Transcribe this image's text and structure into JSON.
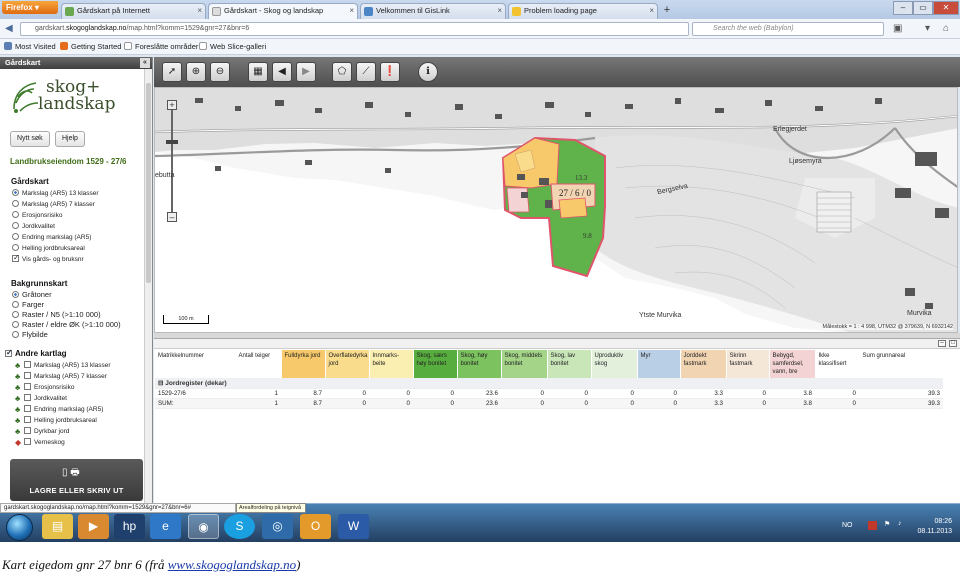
{
  "browser": {
    "menu_label": "Firefox",
    "tabs": [
      {
        "label": "Gårdskart på Internett",
        "favicon": "green-leaf-icon"
      },
      {
        "label": "Gårdskart - Skog og landskap",
        "favicon": "page-icon"
      },
      {
        "label": "Velkommen til GisLink",
        "favicon": "gislink-icon"
      },
      {
        "label": "Problem loading page",
        "favicon": "warning-icon"
      }
    ],
    "new_tab_label": "+",
    "url_prefix": "gardskart.",
    "url_domain": "skogoglandskap.no",
    "url_suffix": "/map.html?komm=1529&gnr=27&bnr=6",
    "search_placeholder": "Search the web (Babylon)",
    "bookmarks": [
      "Most Visited",
      "Getting Started",
      "Foreslåtte områder",
      "Web Slice-galleri"
    ]
  },
  "left_panel": {
    "header": "Gårdskart",
    "logo_line1": "skog+",
    "logo_line2": "landskap",
    "search_button": "Nytt søk",
    "help_button": "Hjelp",
    "property_title": "Landbrukseiendom 1529 - 27/6",
    "gardskart_title": "Gårdskart",
    "gardskart_options": [
      "Markslag (AR5) 13 klasser",
      "Markslag (AR5) 7 klasser",
      "Erosjonsrisiko",
      "Jordkvalitet",
      "Endring markslag (AR5)",
      "Helling jordbruksareal"
    ],
    "gardskart_selected": 0,
    "show_numbers_label": "Vis gårds- og bruksnr",
    "background_title": "Bakgrunnskart",
    "background_options": [
      "Gråtoner",
      "Farger",
      "Raster / N5 (>1:10 000)",
      "Raster / eldre ØK (>1:10 000)",
      "Flybilde"
    ],
    "background_selected": 0,
    "other_maps_title": "Andre kartlag",
    "other_maps": [
      "Markslag (AR5) 13 klasser",
      "Markslag (AR5) 7 klasser",
      "Erosjonsrisiko",
      "Jordkvalitet",
      "Endring markslag (AR5)",
      "Helling jordbruksareal",
      "Dyrkbar jord",
      "Verneskog"
    ],
    "save_button": "LAGRE ELLER SKRIV UT"
  },
  "toolbar": {
    "buttons": [
      "arrow-pointer-icon",
      "zoom-in-icon",
      "zoom-out-icon",
      "map-grid-icon",
      "back-icon",
      "forward-icon",
      "measure-area-icon",
      "measure-distance-icon",
      "pin-icon",
      "info-icon"
    ]
  },
  "map": {
    "place_labels": [
      "Bergselva",
      "Ljøsemyra",
      "Ytste Murvika",
      "Murvika",
      "Erlegjerdet",
      "ebutta"
    ],
    "parcel_label": "27 / 6 / 0",
    "area_labels": [
      "13.3",
      "9.8"
    ],
    "scale_label": "100 m",
    "scale_info": "Målestokk = 1 : 4 998, UTM32 @ 379639, N 6932142",
    "colors": {
      "skog_high": "#5fb34a",
      "fulldyrka": "#f7c96a",
      "parcel_border": "#e0556b"
    }
  },
  "table": {
    "headers": [
      "Matrikkelnummer",
      "Antall teiger",
      "Fulldyrka jord",
      "Overflatedyrka jord",
      "Innmarks-beite",
      "Skog, særs høy bonitet",
      "Skog, høy bonitet",
      "Skog, middels bonitet",
      "Skog, lav bonitet",
      "Uproduktiv skog",
      "Myr",
      "Jorddekt fastmark",
      "Skrinn fastmark",
      "Bebygd, samferdsel, vann, bre",
      "Ikke klassifisert",
      "Sum grunnareal"
    ],
    "header_colors": [
      "#ffffff",
      "#ffffff",
      "#f7c96a",
      "#f9dc8c",
      "#faeeb0",
      "#57ad3d",
      "#7cc25e",
      "#a3d488",
      "#c8e6b8",
      "#e2f0dc",
      "#b9cfe6",
      "#f1d4b2",
      "#f4e7d8",
      "#f3d3d3",
      "#ffffff",
      "#ffffff"
    ],
    "group_label": "Jordregister (dekar)",
    "rows": [
      {
        "cells": [
          "1529-27/6",
          "1",
          "8.7",
          "0",
          "0",
          "0",
          "23.6",
          "0",
          "0",
          "0",
          "0",
          "3.3",
          "0",
          "3.8",
          "0",
          "39.3"
        ]
      },
      {
        "cells": [
          "SUM:",
          "1",
          "8.7",
          "0",
          "0",
          "0",
          "23.6",
          "0",
          "0",
          "0",
          "0",
          "3.3",
          "0",
          "3.8",
          "0",
          "39.3"
        ]
      }
    ]
  },
  "status": {
    "url": "gardskart.skogoglandskap.no/map.html?komm=1529&gnr=27&bnr=6#",
    "tooltip": "Arealfordeling på teignivå"
  },
  "taskbar": {
    "apps": [
      "explorer-icon",
      "media-player-icon",
      "hp-icon",
      "internet-explorer-icon",
      "firefox-icon",
      "skype-icon",
      "network-icon",
      "outlook-icon",
      "word-icon"
    ],
    "language": "NO",
    "time": "08:26",
    "date": "08.11.2013"
  },
  "caption": {
    "text": "Kart eigedom gnr 27 bnr 6 (frå ",
    "link": "www.skogoglandskap.no",
    "suffix": ")"
  }
}
